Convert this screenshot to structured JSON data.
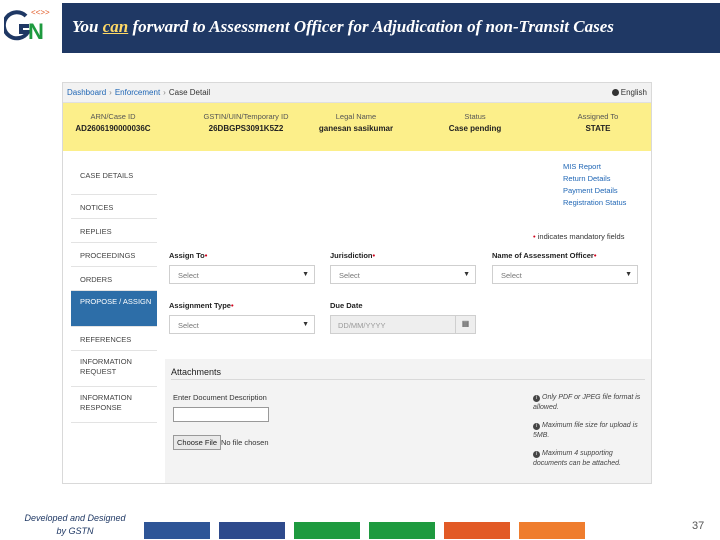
{
  "slide": {
    "logo": "GSTN",
    "title_prefix": "You ",
    "title_highlight": "can",
    "title_suffix": " forward to Assessment Officer for Adjudication of non-Transit Cases",
    "footer_line1": "Developed and Designed",
    "footer_line2": "by GSTN",
    "page_number": "37",
    "strip_colors": [
      "#2e5597",
      "#2e4a8c",
      "#1e9a3f",
      "#1e9a3f",
      "#e25a26",
      "#ef7d2e"
    ]
  },
  "breadcrumb": [
    "Dashboard",
    "Enforcement",
    "Case Detail"
  ],
  "language": "English",
  "case_header": [
    {
      "label": "ARN/Case ID",
      "value": "AD2606190000036C"
    },
    {
      "label": "GSTIN/UIN/Temporary ID",
      "value": "26DBGPS3091K5Z2"
    },
    {
      "label": "Legal Name",
      "value": "ganesan sasikumar"
    },
    {
      "label": "Status",
      "value": "Case pending"
    },
    {
      "label": "Assigned To",
      "value": "STATE"
    }
  ],
  "sidebar": [
    "CASE DETAILS",
    "NOTICES",
    "REPLIES",
    "PROCEEDINGS",
    "ORDERS",
    "PROPOSE / ASSIGN",
    "REFERENCES",
    "INFORMATION REQUEST",
    "INFORMATION RESPONSE"
  ],
  "links": [
    "MIS Report",
    "Return Details",
    "Payment Details",
    "Registration Status"
  ],
  "mandatory_note": "indicates mandatory fields",
  "form": {
    "assign_to_label": "Assign To",
    "assign_to_value": "Select",
    "jurisdiction_label": "Jurisdiction",
    "jurisdiction_value": "Select",
    "officer_label": "Name of Assessment Officer",
    "officer_value": "Select",
    "assignment_type_label": "Assignment Type",
    "assignment_type_value": "Select",
    "due_date_label": "Due Date",
    "due_date_placeholder": "DD/MM/YYYY"
  },
  "attachments": {
    "title": "Attachments",
    "doc_label": "Enter Document Description",
    "choose_file": "Choose File",
    "no_file": "No file chosen",
    "notes": [
      "Only PDF or JPEG file format is allowed.",
      "Maximum file size for upload is 5MB.",
      "Maximum 4 supporting documents can be attached."
    ]
  }
}
